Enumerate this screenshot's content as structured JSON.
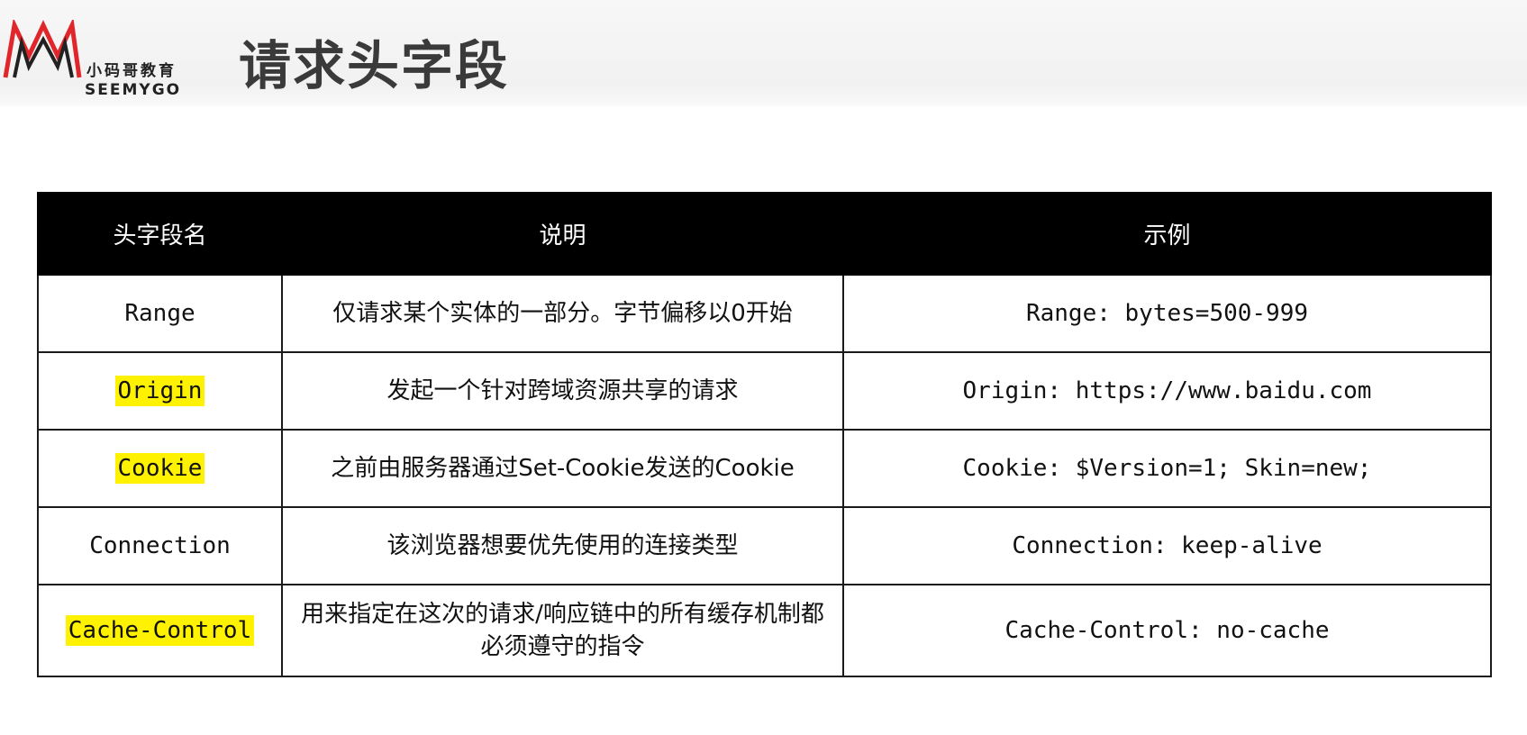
{
  "logo": {
    "cn_text": "小码哥教育",
    "en_text": "SEEMYGO"
  },
  "page_title": "请求头字段",
  "table": {
    "columns": [
      "头字段名",
      "说明",
      "示例"
    ],
    "rows": [
      {
        "name": "Range",
        "highlighted": false,
        "description": "仅请求某个实体的一部分。字节偏移以0开始",
        "example": "Range: bytes=500-999"
      },
      {
        "name": "Origin",
        "highlighted": true,
        "description": "发起一个针对跨域资源共享的请求",
        "example": "Origin: https://www.baidu.com"
      },
      {
        "name": "Cookie",
        "highlighted": true,
        "description": "之前由服务器通过Set-Cookie发送的Cookie",
        "example": "Cookie: $Version=1; Skin=new;"
      },
      {
        "name": "Connection",
        "highlighted": false,
        "description": "该浏览器想要优先使用的连接类型",
        "example": "Connection: keep-alive"
      },
      {
        "name": "Cache-Control",
        "highlighted": true,
        "description": "用来指定在这次的请求/响应链中的所有缓存机制都必须遵守的指令",
        "example": "Cache-Control: no-cache"
      }
    ]
  },
  "colors": {
    "header_bg": "#000000",
    "highlight": "#fff200",
    "logo_red": "#e0262b"
  }
}
